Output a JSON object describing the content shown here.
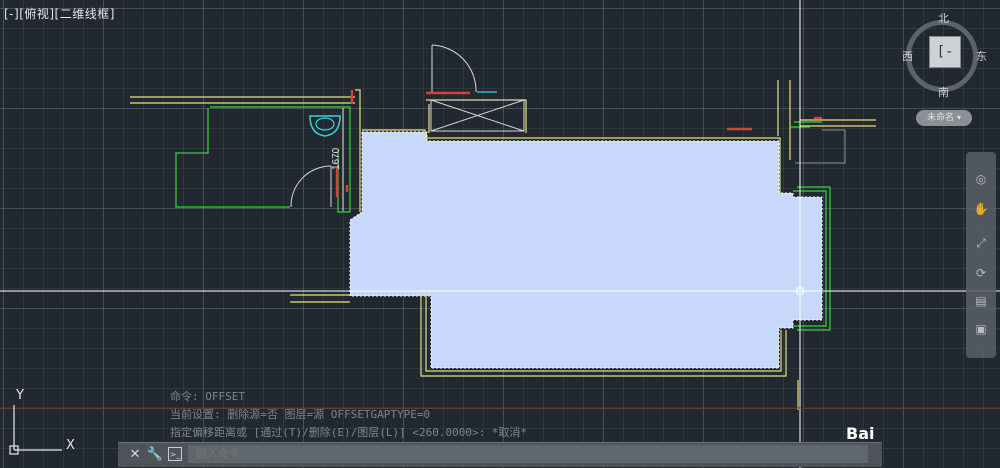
{
  "viewport": {
    "label": "[-][俯视][二维线框]"
  },
  "viewcube": {
    "north": "北",
    "south": "南",
    "east": "东",
    "west": "西",
    "face_glyph": "[-"
  },
  "ucs_selector": {
    "label": "未命名",
    "chevron": "▾"
  },
  "drawing": {
    "dimension_text": "1670"
  },
  "command_history": {
    "line1": "命令:  OFFSET",
    "line2": "当前设置:  删除源=否   图层=源   OFFSETGAPTYPE=0",
    "line3": "指定偏移距离或 [通过(T)/删除(E)/图层(L)] <260.0000>:  *取消*"
  },
  "command_line": {
    "close_glyph": "✕",
    "settings_glyph": "🔧",
    "prompt_glyph": ">_",
    "dropdown_glyph": "▾",
    "placeholder": "键入命令"
  },
  "ucs": {
    "x_label": "X",
    "y_label": "Y"
  },
  "watermark": {
    "text": "Bai"
  },
  "colors": {
    "background": "#212830",
    "hatch_fill": "#c8d8fa",
    "wall_yellow": "#e8e07a",
    "fixture_green": "#3ad23a",
    "door_red": "#d84040",
    "crosshair": "#ffffff"
  }
}
